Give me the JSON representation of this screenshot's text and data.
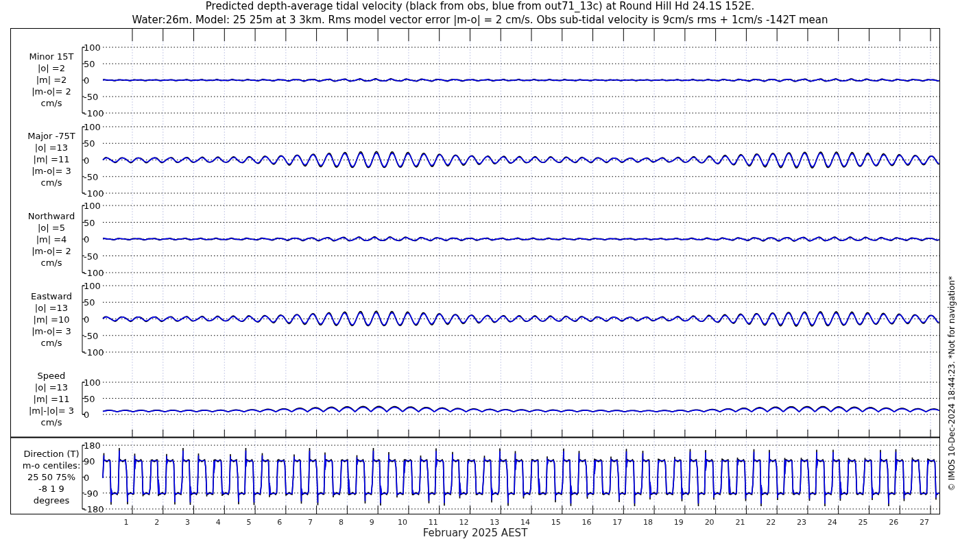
{
  "title": [
    "Predicted depth-average tidal velocity (black from obs, blue from out71_13c) at Round Hill Hd 24.1S 152E.",
    "Water:26m. Model: 25 25m at 3 3km. Rms model vector error |m-o| = 2 cm/s. Obs sub-tidal velocity is 9cm/s rms + 1cm/s -142T mean"
  ],
  "panels": [
    {
      "kind": "minor",
      "label": [
        "Minor 15T",
        "|o| =2",
        "|m| =2",
        "|m-o|= 2",
        "cm/s"
      ],
      "yticks": [
        "100",
        "50",
        "0",
        "-50",
        "-100"
      ]
    },
    {
      "kind": "major",
      "label": [
        "Major -75T",
        "|o| =13",
        "|m| =11",
        "|m-o|= 3",
        "cm/s"
      ],
      "yticks": [
        "100",
        "50",
        "0",
        "-50",
        "-100"
      ]
    },
    {
      "kind": "northward",
      "label": [
        "Northward",
        "|o| =5",
        "|m| =4",
        "|m-o|= 2",
        "cm/s"
      ],
      "yticks": [
        "100",
        "50",
        "0",
        "-50",
        "-100"
      ]
    },
    {
      "kind": "eastward",
      "label": [
        "Eastward",
        "|o| =13",
        "|m| =10",
        "|m-o|= 3",
        "cm/s"
      ],
      "yticks": [
        "100",
        "50",
        "0",
        "-50",
        "-100"
      ]
    },
    {
      "kind": "speed",
      "label": [
        "Speed",
        "|o| =13",
        "|m| =11",
        "|m|-|o|= 3",
        "cm/s"
      ],
      "yticks": [
        "100",
        "50",
        "0"
      ]
    },
    {
      "kind": "direction",
      "label": [
        "Direction (T)",
        "m-o centiles:",
        "25  50  75%",
        "-8  1  9",
        "degrees"
      ],
      "yticks": [
        "180",
        "90",
        "0",
        "-90",
        "-180"
      ]
    }
  ],
  "days": [
    "1",
    "2",
    "3",
    "4",
    "5",
    "6",
    "7",
    "8",
    "9",
    "10",
    "11",
    "12",
    "13",
    "14",
    "15",
    "16",
    "17",
    "18",
    "19",
    "20",
    "21",
    "22",
    "23",
    "24",
    "25",
    "26",
    "27"
  ],
  "xlabel": "February 2025 AEST",
  "footer": "© IMOS 10-Dec-2024 18:44:23. *Not for navigation*"
}
